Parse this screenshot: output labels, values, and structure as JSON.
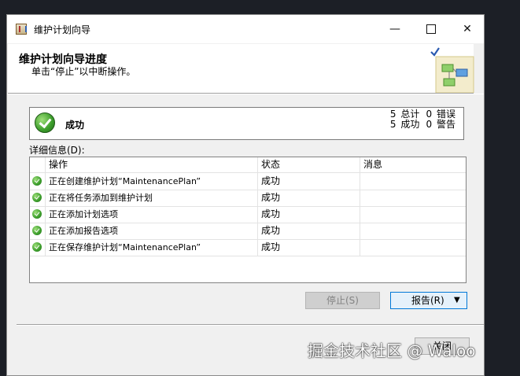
{
  "window": {
    "title": "维护计划向导",
    "minimize_glyph": "—",
    "close_glyph": "✕"
  },
  "header": {
    "title": "维护计划向导进度",
    "subtitle": "单击“停止”以中断操作。"
  },
  "status": {
    "label": "成功",
    "total_count": "5",
    "total_label": "总计",
    "error_count": "0",
    "error_label": "错误",
    "success_count": "5",
    "success_label": "成功",
    "warning_count": "0",
    "warning_label": "警告"
  },
  "details": {
    "label": "详细信息(D):",
    "columns": [
      "操作",
      "状态",
      "消息"
    ],
    "rows": [
      {
        "op": "正在创建维护计划“MaintenancePlan”",
        "status": "成功",
        "message": ""
      },
      {
        "op": "正在将任务添加到维护计划",
        "status": "成功",
        "message": ""
      },
      {
        "op": "正在添加计划选项",
        "status": "成功",
        "message": ""
      },
      {
        "op": "正在添加报告选项",
        "status": "成功",
        "message": ""
      },
      {
        "op": "正在保存维护计划“MaintenancePlan”",
        "status": "成功",
        "message": ""
      }
    ]
  },
  "buttons": {
    "stop": "停止(S)",
    "report": "报告(R)",
    "report_arrow": "▼",
    "close": "关闭"
  },
  "watermark": "掘金技术社区 @ Waloo",
  "colors": {
    "success_green": "#3a9c2a",
    "accent_blue": "#0078d7"
  }
}
